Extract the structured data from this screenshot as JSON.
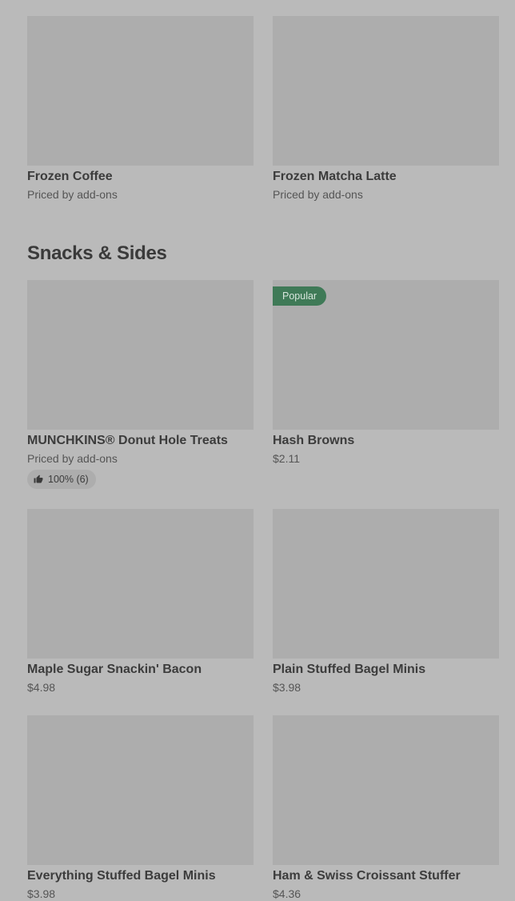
{
  "frozen": [
    {
      "name": "Frozen Coffee",
      "price": "Priced by add-ons"
    },
    {
      "name": "Frozen Matcha Latte",
      "price": "Priced by add-ons"
    }
  ],
  "snacks": {
    "title": "Snacks & Sides",
    "items": [
      {
        "name": "MUNCHKINS® Donut Hole Treats",
        "price": "Priced by add-ons",
        "rating": "100% (6)"
      },
      {
        "name": "Hash Browns",
        "price": "$2.11",
        "badge": "Popular"
      },
      {
        "name": "Maple Sugar Snackin' Bacon",
        "price": "$4.98"
      },
      {
        "name": "Plain Stuffed Bagel Minis",
        "price": "$3.98"
      },
      {
        "name": "Everything Stuffed Bagel Minis",
        "price": "$3.98"
      },
      {
        "name": "Ham & Swiss Croissant Stuffer",
        "price": "$4.36"
      }
    ]
  }
}
